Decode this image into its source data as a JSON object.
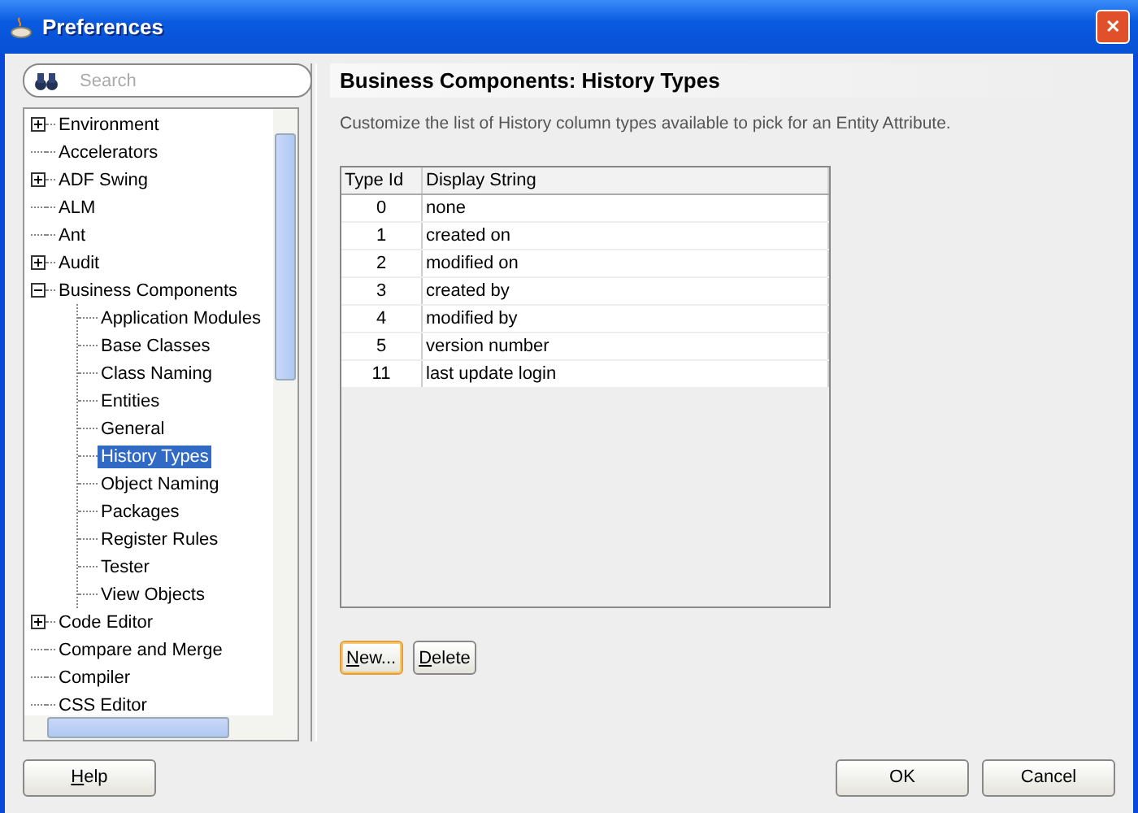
{
  "window": {
    "title": "Preferences",
    "close": "✕"
  },
  "search": {
    "placeholder": "Search"
  },
  "tree": [
    {
      "label": "Environment",
      "expanded": false,
      "selected": false
    },
    {
      "label": "Accelerators",
      "selected": false
    },
    {
      "label": "ADF Swing",
      "expanded": false,
      "selected": false
    },
    {
      "label": "ALM",
      "selected": false
    },
    {
      "label": "Ant",
      "selected": false
    },
    {
      "label": "Audit",
      "expanded": false,
      "selected": false
    },
    {
      "label": "Business Components",
      "expanded": true,
      "selected": false,
      "children": [
        {
          "label": "Application Modules",
          "selected": false
        },
        {
          "label": "Base Classes",
          "selected": false
        },
        {
          "label": "Class Naming",
          "selected": false
        },
        {
          "label": "Entities",
          "selected": false
        },
        {
          "label": "General",
          "selected": false
        },
        {
          "label": "History Types",
          "selected": true
        },
        {
          "label": "Object Naming",
          "selected": false
        },
        {
          "label": "Packages",
          "selected": false
        },
        {
          "label": "Register Rules",
          "selected": false
        },
        {
          "label": "Tester",
          "selected": false
        },
        {
          "label": "View Objects",
          "selected": false
        }
      ]
    },
    {
      "label": "Code Editor",
      "expanded": false,
      "selected": false
    },
    {
      "label": "Compare and Merge",
      "selected": false
    },
    {
      "label": "Compiler",
      "selected": false
    },
    {
      "label": "CSS Editor",
      "selected": false
    }
  ],
  "page": {
    "title": "Business Components: History Types",
    "description": "Customize the list of History column types available to pick for an Entity Attribute."
  },
  "table": {
    "columns": [
      "Type Id",
      "Display String"
    ],
    "rows": [
      [
        "0",
        "none"
      ],
      [
        "1",
        "created on"
      ],
      [
        "2",
        "modified on"
      ],
      [
        "3",
        "created by"
      ],
      [
        "4",
        "modified by"
      ],
      [
        "5",
        "version number"
      ],
      [
        "11",
        "last update login"
      ]
    ]
  },
  "table_buttons": [
    {
      "label": "New...",
      "focused": true
    },
    {
      "label": "Delete",
      "focused": false
    }
  ],
  "footer": {
    "help": "Help",
    "buttons": [
      "OK",
      "Cancel"
    ]
  }
}
